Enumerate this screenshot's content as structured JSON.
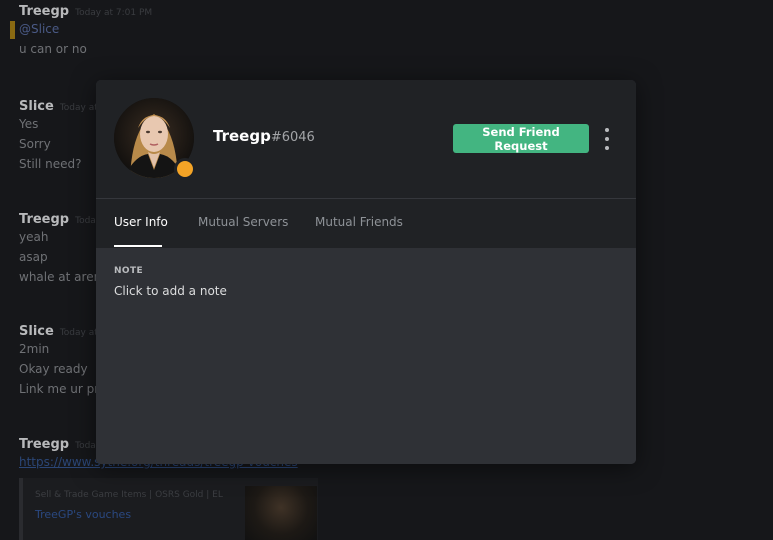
{
  "chat": {
    "messages": [
      {
        "author": "Treegp",
        "timestamp": "Today at 7:01 PM",
        "lines": [
          "u can or no"
        ],
        "mention": "@Slice"
      },
      {
        "author": "Slice",
        "timestamp": "Today at",
        "lines": [
          "Yes",
          "Sorry",
          "Still need?"
        ]
      },
      {
        "author": "Treegp",
        "timestamp": "Today",
        "lines": [
          "yeah",
          "asap",
          "whale at arena"
        ]
      },
      {
        "author": "Slice",
        "timestamp": "Today at",
        "lines": [
          "2min",
          "Okay ready",
          "Link me ur pro"
        ]
      },
      {
        "author": "Treegp",
        "timestamp": "Today",
        "link": "https://www.sythe.org/threads/treegp-vouches"
      }
    ],
    "embed": {
      "provider": "Sell & Trade Game Items | OSRS Gold | EL",
      "title": "TreeGP's vouches"
    }
  },
  "profile": {
    "username": "Treegp",
    "discriminator": "#6046",
    "status_color": "#f4a426",
    "send_button": "Send Friend Request",
    "more_icon": "kebab-icon",
    "tabs": [
      {
        "label": "User Info",
        "active": true
      },
      {
        "label": "Mutual Servers",
        "active": false
      },
      {
        "label": "Mutual Friends",
        "active": false
      }
    ],
    "note_label": "NOTE",
    "note_placeholder": "Click to add a note"
  },
  "colors": {
    "accent_button": "#43b581",
    "modal_bg": "#2f3136",
    "header_bg": "#202225"
  }
}
